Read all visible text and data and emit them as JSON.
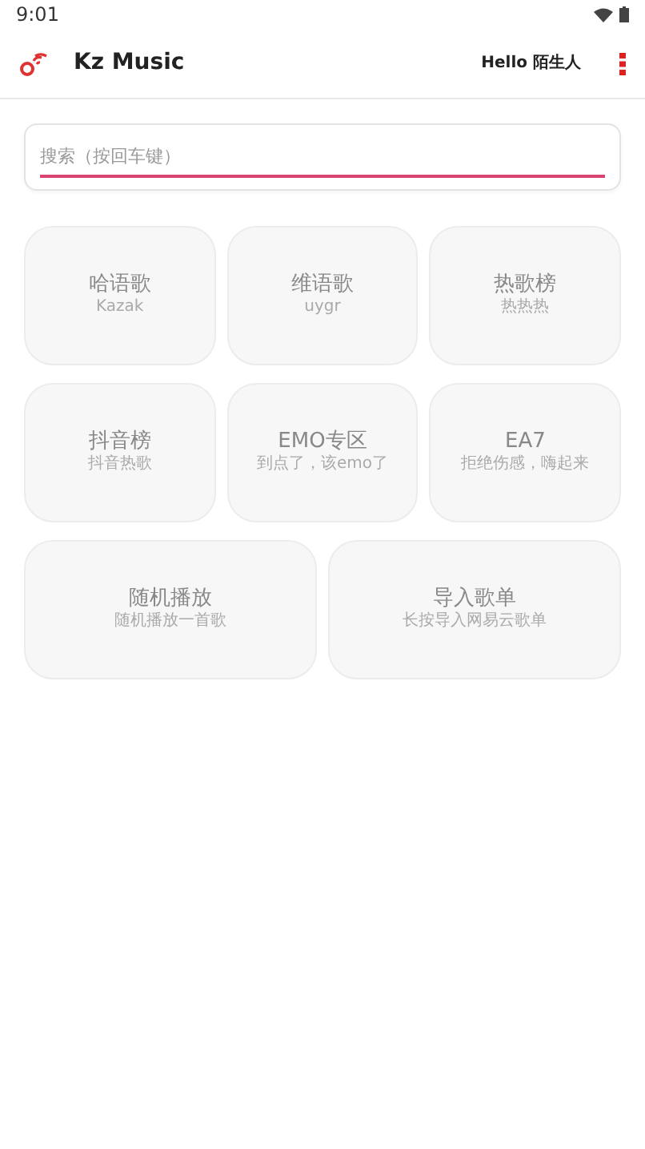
{
  "status_bar": {
    "time": "9:01"
  },
  "app_bar": {
    "title": "Kz Music",
    "greeting": "Hello 陌生人"
  },
  "search": {
    "placeholder": "搜索（按回车键）"
  },
  "tile_rows": [
    {
      "tiles": [
        {
          "title": "哈语歌",
          "subtitle": "Kazak"
        },
        {
          "title": "维语歌",
          "subtitle": "uygr"
        },
        {
          "title": "热歌榜",
          "subtitle": "热热热"
        }
      ]
    },
    {
      "tiles": [
        {
          "title": "抖音榜",
          "subtitle": "抖音热歌"
        },
        {
          "title": "EMO专区",
          "subtitle": "到点了，该emo了"
        },
        {
          "title": "EA7",
          "subtitle": "拒绝伤感，嗨起来"
        }
      ]
    },
    {
      "tiles": [
        {
          "title": "随机播放",
          "subtitle": "随机播放一首歌"
        },
        {
          "title": "导入歌单",
          "subtitle": "长按导入网易云歌单"
        }
      ]
    }
  ]
}
